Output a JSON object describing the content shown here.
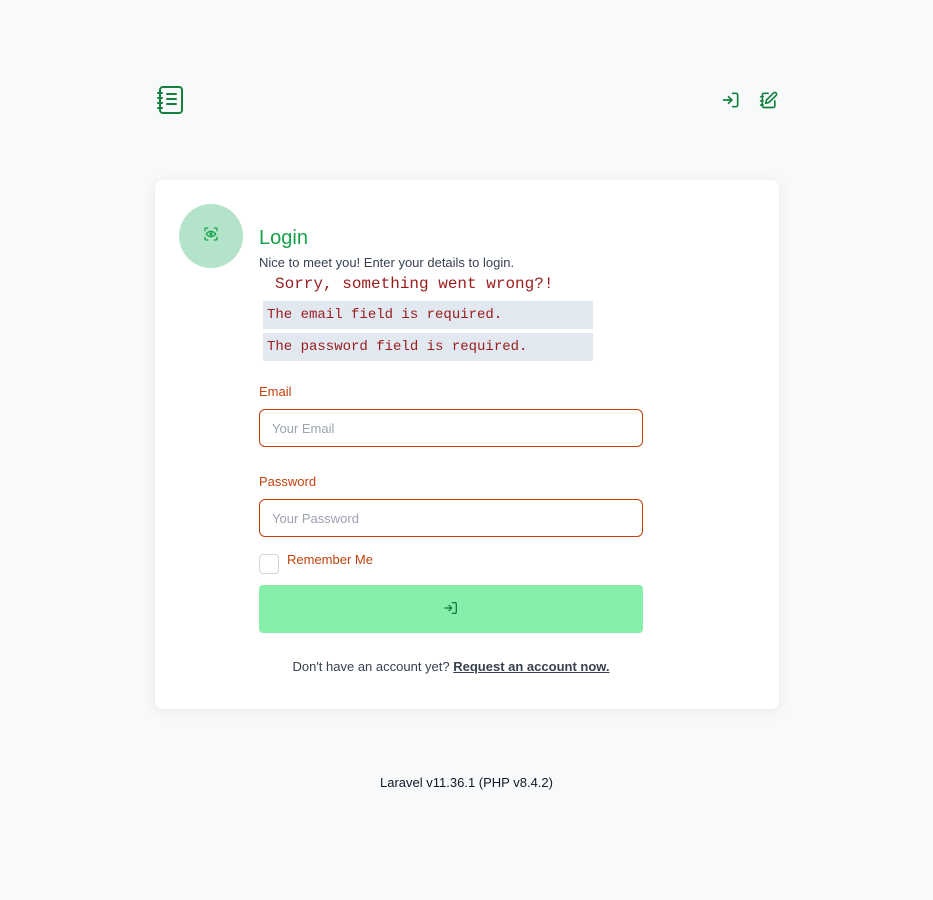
{
  "login": {
    "title": "Login",
    "subtitle": "Nice to meet you! Enter your details to login.",
    "error_heading": "Sorry, something went wrong?!",
    "errors": [
      "The email field is required.",
      "The password field is required."
    ],
    "email": {
      "label": "Email",
      "placeholder": "Your Email",
      "value": ""
    },
    "password": {
      "label": "Password",
      "placeholder": "Your Password",
      "value": ""
    },
    "remember_label": "Remember Me",
    "remember_checked": false,
    "signup_prompt": "Don't have an account yet?",
    "signup_link": "Request an account now."
  },
  "footer": {
    "version": "Laravel v11.36.1 (PHP v8.4.2)"
  },
  "icons": {
    "logo": "notebook-icon",
    "nav_login": "login-icon",
    "nav_register": "edit-icon",
    "avatar": "eye-scan-icon",
    "submit": "login-icon"
  },
  "colors": {
    "brand": "#16a34a",
    "icon_green": "#15803d",
    "error_text": "#991b1b",
    "error_bg": "#e2e8f0",
    "field_accent": "#c2410c",
    "button_bg": "#86efac",
    "avatar_bg": "#b3e3c8",
    "page_bg": "#f7f9fb"
  }
}
